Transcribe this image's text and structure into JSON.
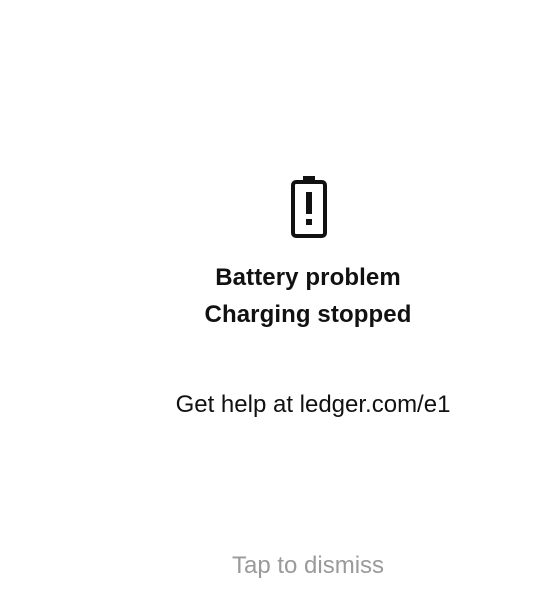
{
  "alert": {
    "icon": "battery-warning-icon",
    "title_line1": "Battery problem",
    "title_line2": "Charging stopped",
    "help_text": "Get help at ledger.com/e1",
    "dismiss_hint": "Tap to dismiss"
  },
  "colors": {
    "background": "#ffffff",
    "text": "#111111",
    "hint": "#9a9a9a"
  }
}
